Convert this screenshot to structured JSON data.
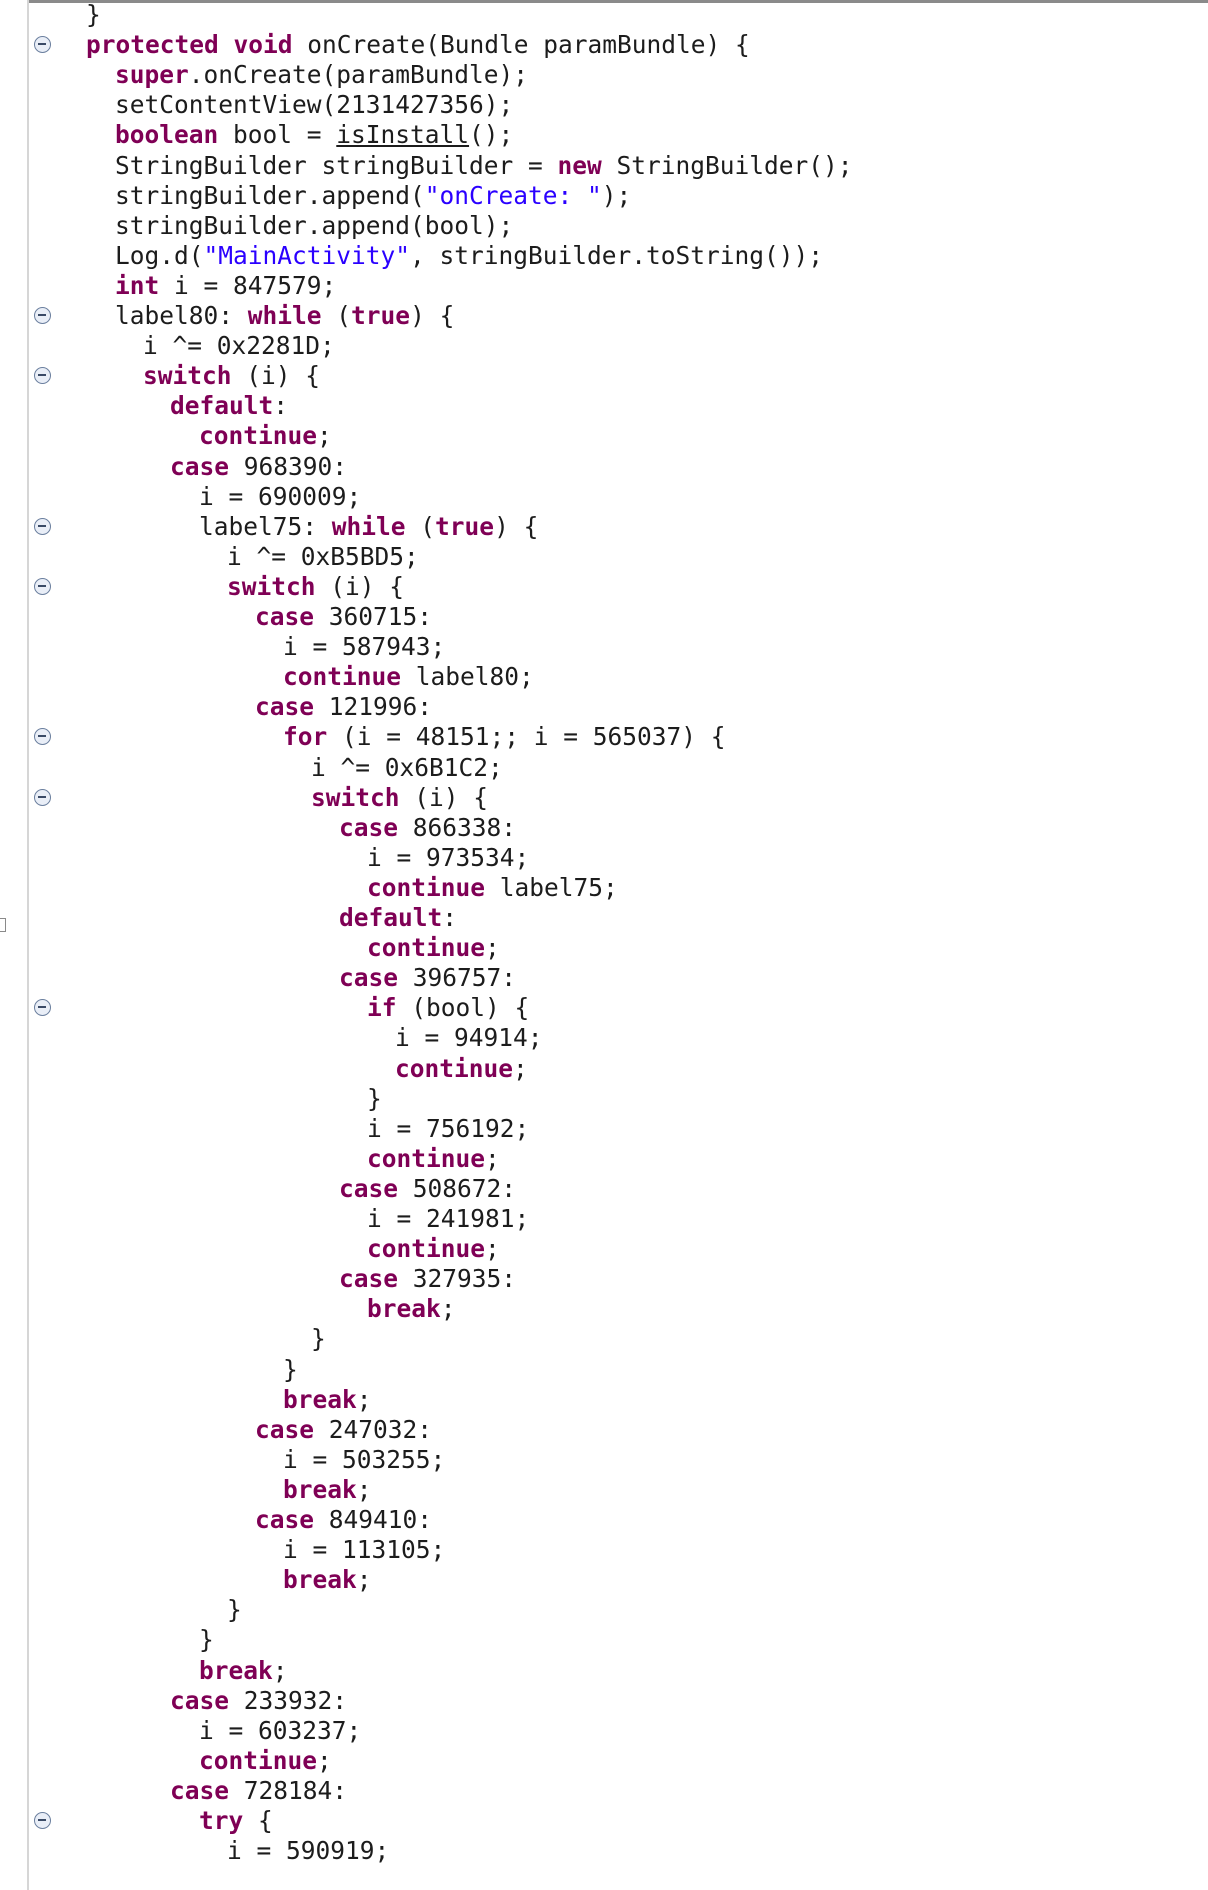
{
  "editor": {
    "lines": [
      {
        "segments": [
          {
            "t": "}",
            "k": "p"
          }
        ]
      },
      {
        "segments": [
          {
            "t": "protected void",
            "k": "kw"
          },
          {
            "t": " onCreate(Bundle paramBundle) {",
            "k": "p"
          }
        ]
      },
      {
        "segments": [
          {
            "t": "super",
            "k": "kw"
          },
          {
            "t": ".onCreate(paramBundle);",
            "k": "p"
          }
        ]
      },
      {
        "segments": [
          {
            "t": "setContentView(2131427356);",
            "k": "p"
          }
        ]
      },
      {
        "segments": [
          {
            "t": "boolean",
            "k": "kw"
          },
          {
            "t": " bool = ",
            "k": "p"
          },
          {
            "t": "isInstall",
            "k": "u"
          },
          {
            "t": "();",
            "k": "p"
          }
        ]
      },
      {
        "segments": [
          {
            "t": "StringBuilder stringBuilder = ",
            "k": "p"
          },
          {
            "t": "new",
            "k": "kw"
          },
          {
            "t": " StringBuilder();",
            "k": "p"
          }
        ]
      },
      {
        "segments": [
          {
            "t": "stringBuilder.append(",
            "k": "p"
          },
          {
            "t": "\"onCreate: \"",
            "k": "str"
          },
          {
            "t": ");",
            "k": "p"
          }
        ]
      },
      {
        "segments": [
          {
            "t": "stringBuilder.append(bool);",
            "k": "p"
          }
        ]
      },
      {
        "segments": [
          {
            "t": "Log.d(",
            "k": "p"
          },
          {
            "t": "\"MainActivity\"",
            "k": "str"
          },
          {
            "t": ", stringBuilder.toString());",
            "k": "p"
          }
        ]
      },
      {
        "segments": [
          {
            "t": "int",
            "k": "kw"
          },
          {
            "t": " i = 847579;",
            "k": "p"
          }
        ]
      },
      {
        "segments": [
          {
            "t": "label80: ",
            "k": "p"
          },
          {
            "t": "while",
            "k": "kw"
          },
          {
            "t": " (",
            "k": "p"
          },
          {
            "t": "true",
            "k": "kw"
          },
          {
            "t": ") {",
            "k": "p"
          }
        ]
      },
      {
        "segments": [
          {
            "t": "i ^= 0x2281D;",
            "k": "p"
          }
        ]
      },
      {
        "segments": [
          {
            "t": "switch",
            "k": "kw"
          },
          {
            "t": " (i) {",
            "k": "p"
          }
        ]
      },
      {
        "segments": [
          {
            "t": "default",
            "k": "kw"
          },
          {
            "t": ":",
            "k": "p"
          }
        ]
      },
      {
        "segments": [
          {
            "t": "continue",
            "k": "kw"
          },
          {
            "t": ";",
            "k": "p"
          }
        ]
      },
      {
        "segments": [
          {
            "t": "case",
            "k": "kw"
          },
          {
            "t": " 968390:",
            "k": "p"
          }
        ]
      },
      {
        "segments": [
          {
            "t": "i = 690009;",
            "k": "p"
          }
        ]
      },
      {
        "segments": [
          {
            "t": "label75: ",
            "k": "p"
          },
          {
            "t": "while",
            "k": "kw"
          },
          {
            "t": " (",
            "k": "p"
          },
          {
            "t": "true",
            "k": "kw"
          },
          {
            "t": ") {",
            "k": "p"
          }
        ]
      },
      {
        "segments": [
          {
            "t": "i ^= 0xB5BD5;",
            "k": "p"
          }
        ]
      },
      {
        "segments": [
          {
            "t": "switch",
            "k": "kw"
          },
          {
            "t": " (i) {",
            "k": "p"
          }
        ]
      },
      {
        "segments": [
          {
            "t": "case",
            "k": "kw"
          },
          {
            "t": " 360715:",
            "k": "p"
          }
        ]
      },
      {
        "segments": [
          {
            "t": "i = 587943;",
            "k": "p"
          }
        ]
      },
      {
        "segments": [
          {
            "t": "continue",
            "k": "kw"
          },
          {
            "t": " label80;",
            "k": "p"
          }
        ]
      },
      {
        "segments": [
          {
            "t": "case",
            "k": "kw"
          },
          {
            "t": " 121996:",
            "k": "p"
          }
        ]
      },
      {
        "segments": [
          {
            "t": "for",
            "k": "kw"
          },
          {
            "t": " (i = 48151;; i = 565037) {",
            "k": "p"
          }
        ]
      },
      {
        "segments": [
          {
            "t": "i ^= 0x6B1C2;",
            "k": "p"
          }
        ]
      },
      {
        "segments": [
          {
            "t": "switch",
            "k": "kw"
          },
          {
            "t": " (i) {",
            "k": "p"
          }
        ]
      },
      {
        "segments": [
          {
            "t": "case",
            "k": "kw"
          },
          {
            "t": " 866338:",
            "k": "p"
          }
        ]
      },
      {
        "segments": [
          {
            "t": "i = 973534;",
            "k": "p"
          }
        ]
      },
      {
        "segments": [
          {
            "t": "continue",
            "k": "kw"
          },
          {
            "t": " label75;",
            "k": "p"
          }
        ]
      },
      {
        "segments": [
          {
            "t": "default",
            "k": "kw"
          },
          {
            "t": ":",
            "k": "p"
          }
        ]
      },
      {
        "segments": [
          {
            "t": "continue",
            "k": "kw"
          },
          {
            "t": ";",
            "k": "p"
          }
        ]
      },
      {
        "segments": [
          {
            "t": "case",
            "k": "kw"
          },
          {
            "t": " 396757:",
            "k": "p"
          }
        ]
      },
      {
        "segments": [
          {
            "t": "if",
            "k": "kw"
          },
          {
            "t": " (bool) {",
            "k": "p"
          }
        ]
      },
      {
        "segments": [
          {
            "t": "i = 94914;",
            "k": "p"
          }
        ]
      },
      {
        "segments": [
          {
            "t": "continue",
            "k": "kw"
          },
          {
            "t": ";",
            "k": "p"
          }
        ]
      },
      {
        "segments": [
          {
            "t": "}",
            "k": "p"
          }
        ]
      },
      {
        "segments": [
          {
            "t": "i = 756192;",
            "k": "p"
          }
        ]
      },
      {
        "segments": [
          {
            "t": "continue",
            "k": "kw"
          },
          {
            "t": ";",
            "k": "p"
          }
        ]
      },
      {
        "segments": [
          {
            "t": "case",
            "k": "kw"
          },
          {
            "t": " 508672:",
            "k": "p"
          }
        ]
      },
      {
        "segments": [
          {
            "t": "i = 241981;",
            "k": "p"
          }
        ]
      },
      {
        "segments": [
          {
            "t": "continue",
            "k": "kw"
          },
          {
            "t": ";",
            "k": "p"
          }
        ]
      },
      {
        "segments": [
          {
            "t": "case",
            "k": "kw"
          },
          {
            "t": " 327935:",
            "k": "p"
          }
        ]
      },
      {
        "segments": [
          {
            "t": "break",
            "k": "kw"
          },
          {
            "t": ";",
            "k": "p"
          }
        ]
      },
      {
        "segments": [
          {
            "t": "}",
            "k": "p"
          }
        ]
      },
      {
        "segments": [
          {
            "t": "}",
            "k": "p"
          }
        ]
      },
      {
        "segments": [
          {
            "t": "break",
            "k": "kw"
          },
          {
            "t": ";",
            "k": "p"
          }
        ]
      },
      {
        "segments": [
          {
            "t": "case",
            "k": "kw"
          },
          {
            "t": " 247032:",
            "k": "p"
          }
        ]
      },
      {
        "segments": [
          {
            "t": "i = 503255;",
            "k": "p"
          }
        ]
      },
      {
        "segments": [
          {
            "t": "break",
            "k": "kw"
          },
          {
            "t": ";",
            "k": "p"
          }
        ]
      },
      {
        "segments": [
          {
            "t": "case",
            "k": "kw"
          },
          {
            "t": " 849410:",
            "k": "p"
          }
        ]
      },
      {
        "segments": [
          {
            "t": "i = 113105;",
            "k": "p"
          }
        ]
      },
      {
        "segments": [
          {
            "t": "break",
            "k": "kw"
          },
          {
            "t": ";",
            "k": "p"
          }
        ]
      },
      {
        "segments": [
          {
            "t": "}",
            "k": "p"
          }
        ]
      },
      {
        "segments": [
          {
            "t": "}",
            "k": "p"
          }
        ]
      },
      {
        "segments": [
          {
            "t": "break",
            "k": "kw"
          },
          {
            "t": ";",
            "k": "p"
          }
        ]
      },
      {
        "segments": [
          {
            "t": "case",
            "k": "kw"
          },
          {
            "t": " 233932:",
            "k": "p"
          }
        ]
      },
      {
        "segments": [
          {
            "t": "i = 603237;",
            "k": "p"
          }
        ]
      },
      {
        "segments": [
          {
            "t": "continue",
            "k": "kw"
          },
          {
            "t": ";",
            "k": "p"
          }
        ]
      },
      {
        "segments": [
          {
            "t": "case",
            "k": "kw"
          },
          {
            "t": " 728184:",
            "k": "p"
          }
        ]
      },
      {
        "segments": [
          {
            "t": "try",
            "k": "kw"
          },
          {
            "t": " {",
            "k": "p"
          }
        ]
      },
      {
        "segments": [
          {
            "t": "i = 590919;",
            "k": "p"
          }
        ]
      }
    ]
  }
}
